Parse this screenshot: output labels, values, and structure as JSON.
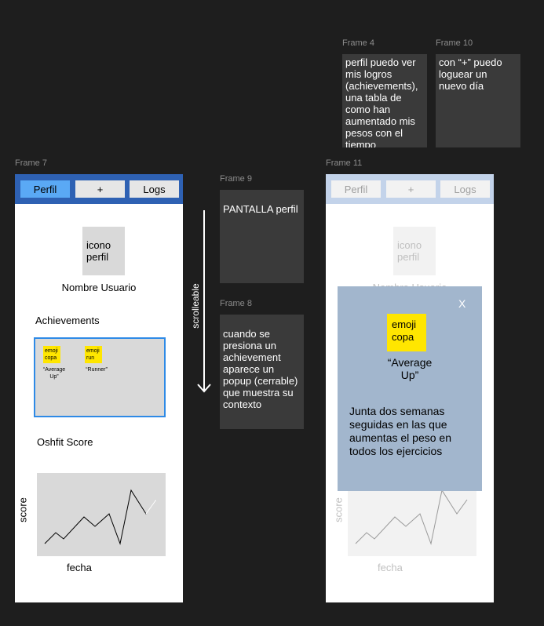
{
  "frames": {
    "frame4": {
      "label": "Frame 4",
      "note": "perfil puedo ver mis logros (achievements), una tabla de como han aumentado mis pesos con el tiempo"
    },
    "frame10": {
      "label": "Frame 10",
      "note": "con “+” puedo loguear un nuevo día"
    },
    "frame7": {
      "label": "Frame 7",
      "tabs": [
        "Perfil",
        "+",
        "Logs"
      ],
      "icon_text": "icono perfil",
      "username": "Nombre Usuario",
      "achievements_title": "Achievements",
      "achievements": [
        {
          "emoji": "emoji copa",
          "name": "“Average Up”"
        },
        {
          "emoji": "emoji run",
          "name": "“Runner”"
        }
      ],
      "score_title": "Oshfit Score",
      "chart_ylabel": "score",
      "chart_xlabel": "fecha"
    },
    "frame9": {
      "label": "Frame 9",
      "note": "PANTALLA perfil"
    },
    "frame8": {
      "label": "Frame 8",
      "note": "cuando se presiona un achievement aparece un popup (cerrable) que muestra su contexto"
    },
    "scroll_label": "scrolleable",
    "frame11": {
      "label": "Frame 11",
      "tabs": [
        "Perfil",
        "+",
        "Logs"
      ],
      "icon_text": "icono perfil",
      "username": "Nombre Usuario",
      "chart_ylabel": "score",
      "chart_xlabel": "fecha",
      "popup": {
        "close": "X",
        "emoji": "emoji copa",
        "name": "“Average Up”",
        "description": "Junta dos semanas seguidas en las que aumentas el peso en todos los ejercicios"
      }
    }
  },
  "colors": {
    "canvas": "#1e1e1e",
    "note_bg": "#3a3a3a",
    "nav_blue": "#2e61b3",
    "active_tab": "#5aa9f5",
    "nav_light": "#c3d3ea",
    "popup_bg": "#a2b6cd",
    "sticky": "#ffe600"
  }
}
